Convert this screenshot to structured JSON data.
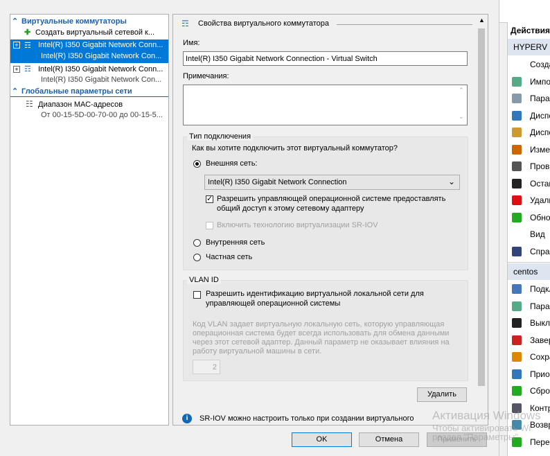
{
  "left_tree": {
    "virtual_switches_header": "Виртуальные коммутаторы",
    "create_switch": "Создать виртуальный сетевой к...",
    "switch1": {
      "name": "Intel(R) I350 Gigabit Network Conn...",
      "sub": "Intel(R) I350 Gigabit Network Con..."
    },
    "switch2": {
      "name": "Intel(R) I350 Gigabit Network Conn...",
      "sub": "Intel(R) I350 Gigabit Network Con..."
    },
    "global_header": "Глобальные параметры сети",
    "mac_range": {
      "name": "Диапазон МАС-адресов",
      "sub": "От 00-15-5D-00-70-00 до 00-15-5..."
    }
  },
  "props": {
    "title": "Свойства виртуального коммутатора",
    "name_label": "Имя:",
    "name_value": "Intel(R) I350 Gigabit Network Connection - Virtual Switch",
    "notes_label": "Примечания:",
    "conn_type": {
      "title": "Тип подключения",
      "question": "Как вы хотите подключить этот виртуальный коммутатор?",
      "external_label": "Внешняя сеть:",
      "adapter_selected": "Intel(R) I350 Gigabit Network Connection",
      "allow_mgmt_line1": "Разрешить управляющей операционной системе предоставлять",
      "allow_mgmt_line2": "общий доступ к этому сетевому адаптеру",
      "sriov_label": "Включить технологию виртуализации SR-IOV",
      "internal_label": "Внутренняя сеть",
      "private_label": "Частная сеть"
    },
    "vlan": {
      "title": "VLAN ID",
      "enable_line1": "Разрешить идентификацию виртуальной локальной сети для",
      "enable_line2": "управляющей операционной системы",
      "desc1": "Код VLAN задает виртуальную локальную сеть, которую управляющая",
      "desc2": "операционная система будет всегда использовать для обмена данными",
      "desc3": "через этот сетевой адаптер. Данный параметр не оказывает влияния на",
      "desc4": "работу виртуальной машины в сети.",
      "value": "2"
    },
    "remove_button": "Удалить",
    "info_text": "SR-IOV можно настроить только при создании виртуального"
  },
  "buttons": {
    "ok": "OK",
    "cancel": "Отмена",
    "apply": "Применить"
  },
  "actions": {
    "header": "Действия",
    "hyperv_section": "HYPERV",
    "hyperv_items": [
      "Созда",
      "Импо",
      "Парам",
      "Диспе",
      "Диспе",
      "Изме",
      "Пров",
      "Остан",
      "Удали",
      "Обно",
      "Вид",
      "Справ"
    ],
    "centos_section": "centos",
    "centos_items": [
      "Подкл",
      "Парам",
      "Выкл",
      "Завер",
      "Сохра",
      "Прио",
      "Сбро",
      "Контр",
      "Возвр",
      "Пере"
    ]
  },
  "watermark": {
    "line1": "Активация Windows",
    "line2": "Чтобы активировать Wi",
    "line3": "раздел \"Параметры\"."
  }
}
